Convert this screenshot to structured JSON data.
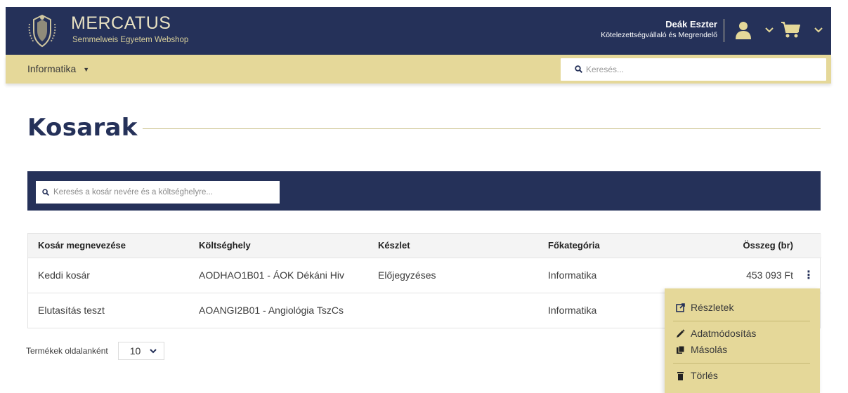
{
  "header": {
    "brand_name": "MERCATUS",
    "brand_subtitle": "Semmelweis Egyetem Webshop",
    "user_name": "Deák Eszter",
    "user_role": "Kötelezettségvállaló és Megrendelő"
  },
  "subnav": {
    "category": "Informatika",
    "search_placeholder": "Keresés..."
  },
  "page": {
    "title": "Kosarak"
  },
  "filter": {
    "search_placeholder": "Keresés a kosár nevére és a költséghelyre..."
  },
  "table": {
    "columns": [
      "Kosár megnevezése",
      "Költséghely",
      "Készlet",
      "Főkategória",
      "Összeg (br)"
    ],
    "rows": [
      [
        "Keddi kosár",
        "AODHAO1B01 - ÁOK Dékáni Hiv",
        "Előjegyzéses",
        "Informatika",
        "453 093 Ft"
      ],
      [
        "Elutasítás teszt",
        "AOANGI2B01 - Angiológia TszCs",
        "",
        "Informatika",
        ""
      ]
    ]
  },
  "pagination": {
    "label": "Termékek oldalanként",
    "per_page": "10"
  },
  "row_menu": {
    "details": "Részletek",
    "edit": "Adatmódosítás",
    "copy": "Másolás",
    "delete": "Törlés"
  },
  "colors": {
    "navy": "#253159",
    "sand": "#e5d899",
    "gold_text": "#e9e2c3"
  }
}
